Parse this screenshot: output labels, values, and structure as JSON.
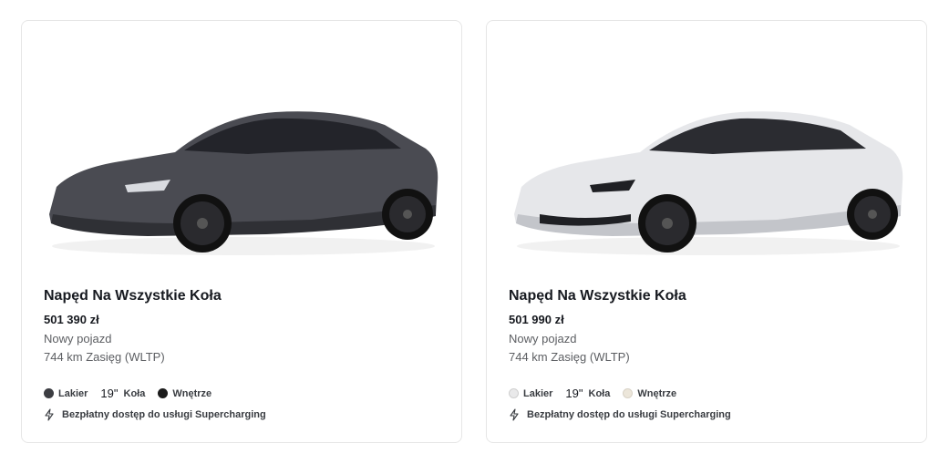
{
  "cards": [
    {
      "title": "Napęd Na Wszystkie Koła",
      "price": "501 390 zł",
      "condition": "Nowy pojazd",
      "range": "744 km Zasięg (WLTP)",
      "paint_label": "Lakier",
      "paint_color": "#3c3d42",
      "wheels_value": "19\"",
      "wheels_label": "Koła",
      "interior_label": "Wnętrze",
      "interior_color": "#1b1b1b",
      "perk": "Bezpłatny dostęp do usługi Supercharging",
      "car_body": "#4a4b52",
      "car_shade": "#2f3035",
      "car_highlight": "#6e6f77"
    },
    {
      "title": "Napęd Na Wszystkie Koła",
      "price": "501 990 zł",
      "condition": "Nowy pojazd",
      "range": "744 km Zasięg (WLTP)",
      "paint_label": "Lakier",
      "paint_color": "#e9e9ea",
      "wheels_value": "19\"",
      "wheels_label": "Koła",
      "interior_label": "Wnętrze",
      "interior_color": "#ece6da",
      "perk": "Bezpłatny dostęp do usługi Supercharging",
      "car_body": "#e6e7ea",
      "car_shade": "#c3c5ca",
      "car_highlight": "#f8f8fa"
    }
  ]
}
